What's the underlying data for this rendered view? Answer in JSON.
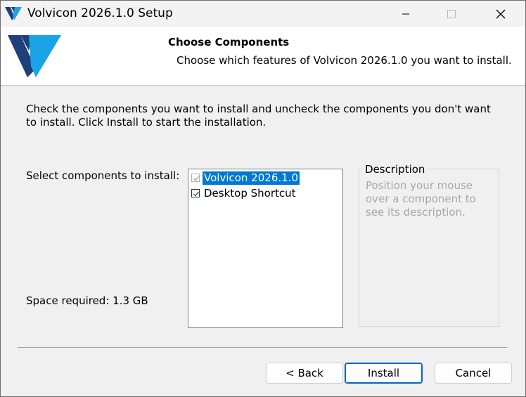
{
  "window": {
    "title": "Volvicon 2026.1.0 Setup"
  },
  "header": {
    "title": "Choose Components",
    "subtitle": "Choose which features of Volvicon 2026.1.0 you want to install."
  },
  "body": {
    "intro": "Check the components you want to install and uncheck the components you don't want to install. Click Install to start the installation.",
    "select_label": "Select components to install:",
    "space_required": "Space required: 1.3 GB"
  },
  "components": [
    {
      "label": "Volvicon 2026.1.0",
      "checked": true,
      "disabled": true,
      "selected": true
    },
    {
      "label": "Desktop Shortcut",
      "checked": true,
      "disabled": false,
      "selected": false
    }
  ],
  "description": {
    "legend": "Description",
    "text": "Position your mouse over a component to see its description."
  },
  "buttons": {
    "back": "< Back",
    "install": "Install",
    "cancel": "Cancel"
  },
  "colors": {
    "selection": "#0078d7",
    "logo_light": "#1aa3e6",
    "logo_dark": "#1e3f7a"
  }
}
